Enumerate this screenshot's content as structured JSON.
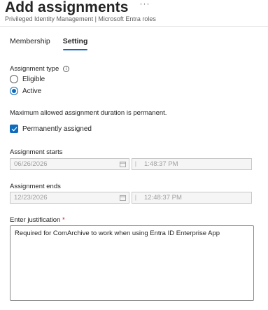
{
  "header": {
    "title": "Add assignments",
    "more_label": "···",
    "subtitle": "Privileged Identity Management | Microsoft Entra roles"
  },
  "tabs": [
    {
      "label": "Membership",
      "active": false
    },
    {
      "label": "Setting",
      "active": true
    }
  ],
  "assignment_type": {
    "label": "Assignment type",
    "info_icon": "i",
    "options": [
      {
        "label": "Eligible",
        "selected": false
      },
      {
        "label": "Active",
        "selected": true
      }
    ]
  },
  "duration_note": "Maximum allowed assignment duration is permanent.",
  "permanently_assigned": {
    "label": "Permanently assigned",
    "checked": true
  },
  "assignment_starts": {
    "label": "Assignment starts",
    "date": "06/26/2026",
    "time": "1:48:37 PM"
  },
  "assignment_ends": {
    "label": "Assignment ends",
    "date": "12/23/2026",
    "time": "12:48:37 PM"
  },
  "justification": {
    "label": "Enter justification",
    "required_marker": "*",
    "value": "Required for ComArchive to work when using Entra ID Enterprise App"
  },
  "colors": {
    "accent": "#0f6cbd",
    "required": "#c50f1f"
  }
}
